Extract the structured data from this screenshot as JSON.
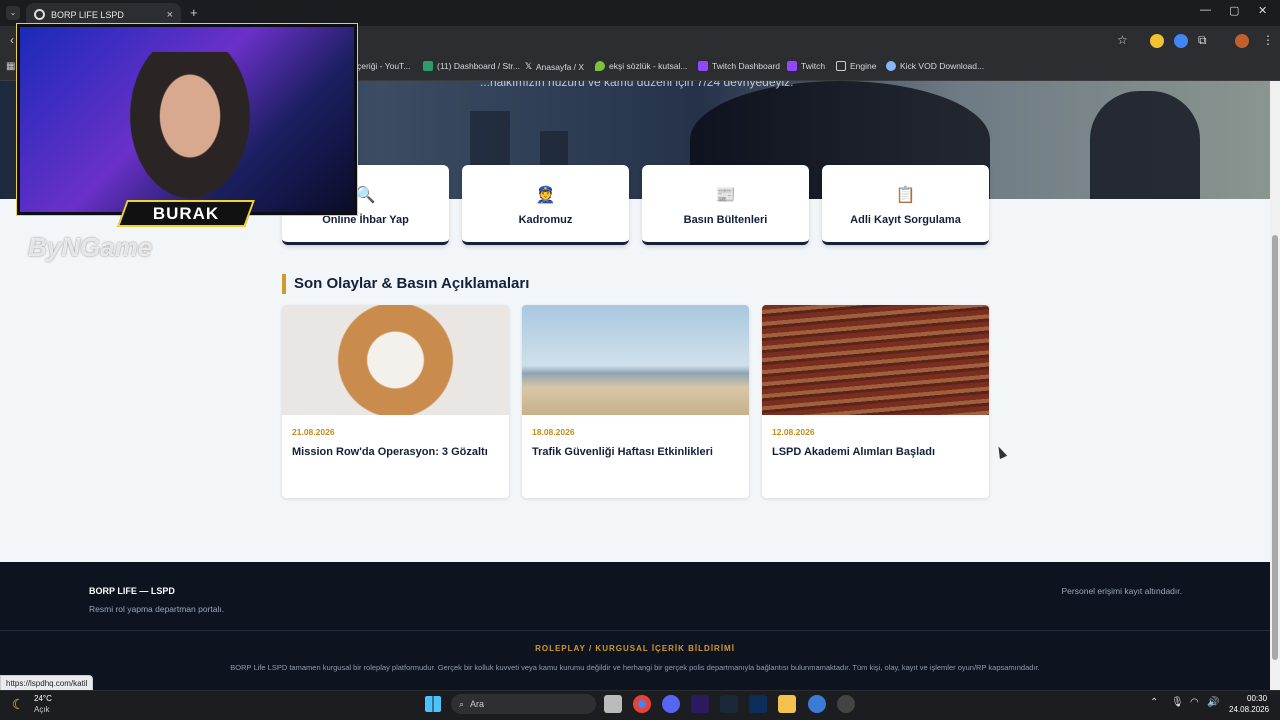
{
  "browser": {
    "tab_title": "BORP LIFE LSPD",
    "tab_close": "×",
    "new_tab": "+",
    "bookmarks": [
      {
        "label": "çeriği - YouT...",
        "color": "#d33"
      },
      {
        "label": "(11) Dashboard / Str...",
        "color": "#2a9d6a"
      },
      {
        "label": "Anasayfa / X",
        "color": "#eee"
      },
      {
        "label": "ekşi sözlük - kutsal...",
        "color": "#7cc136"
      },
      {
        "label": "Twitch Dashboard",
        "color": "#9146ff"
      },
      {
        "label": "Twitch",
        "color": "#9146ff"
      },
      {
        "label": "Engine",
        "color": "#ccc"
      },
      {
        "label": "Kick VOD Download...",
        "color": "#8ab4f8"
      }
    ]
  },
  "hero": {
    "text": "...halkımızın huzuru ve kamu düzeni için 7/24 devriyedeyiz."
  },
  "quick_links": [
    {
      "label": "Online İhbar Yap",
      "icon": "🔍",
      "icon_name": "search-icon"
    },
    {
      "label": "Kadromuz",
      "icon": "👮",
      "icon_name": "police-officer-icon"
    },
    {
      "label": "Basın Bültenleri",
      "icon": "📰",
      "icon_name": "newspaper-icon"
    },
    {
      "label": "Adli Kayıt Sorgulama",
      "icon": "📋",
      "icon_name": "clipboard-icon"
    }
  ],
  "news_section": {
    "title": "Son Olaylar & Basın Açıklamaları",
    "items": [
      {
        "date": "21.08.2026",
        "title": "Mission Row'da Operasyon: 3 Gözaltı"
      },
      {
        "date": "18.08.2026",
        "title": "Trafik Güvenliği Haftası Etkinlikleri"
      },
      {
        "date": "12.08.2026",
        "title": "LSPD Akademi Alımları Başladı"
      }
    ]
  },
  "footer": {
    "title": "BORP LIFE — LSPD",
    "subtitle": "Resmi rol yapma departman portalı.",
    "right_text": "Personel erişimi kayıt altındadır.",
    "disclaimer_title": "ROLEPLAY / KURGUSAL İÇERİK BİLDİRİMİ",
    "disclaimer_text": "BORP Life LSPD tamamen kurgusal bir roleplay platformudur. Gerçek bir kolluk kuvveti veya kamu kurumu değildir ve herhangi bir gerçek polis departmanıyla bağlantısı bulunmamaktadır. Tüm kişi, olay, kayıt ve işlemler oyun/RP kapsamındadır."
  },
  "status_url": "https://lspdhq.com/katil",
  "overlay": {
    "name": "BURAK",
    "watermark": "ByNGame"
  },
  "taskbar": {
    "weather_temp": "24°C",
    "weather_desc": "Açık",
    "search": "Ara",
    "time": "00:30",
    "date": "24.08.2026"
  }
}
